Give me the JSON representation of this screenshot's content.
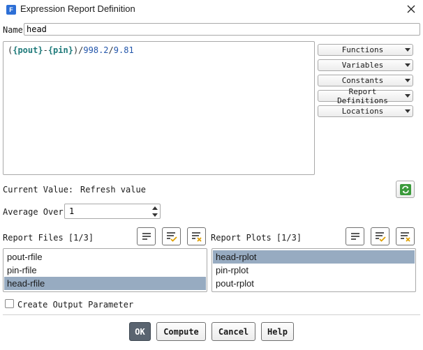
{
  "window": {
    "app_icon_letter": "F",
    "title": "Expression Report Definition"
  },
  "name": {
    "label": "Name",
    "value": "head"
  },
  "expression": {
    "open_paren": "(",
    "var1": "{pout}",
    "minus": "-",
    "var2": "{pin}",
    "rest_paren": ")/",
    "num1": "998.2",
    "slash": "/",
    "num2": "9.81"
  },
  "dropdowns": [
    {
      "label": "Functions"
    },
    {
      "label": "Variables"
    },
    {
      "label": "Constants"
    },
    {
      "label": "Report Definitions"
    },
    {
      "label": "Locations"
    }
  ],
  "current_value": {
    "label": "Current Value:",
    "value": "Refresh value"
  },
  "average_over": {
    "label": "Average Over",
    "value": "1"
  },
  "report_files": {
    "label": "Report Files [1/3]",
    "items": [
      "pout-rfile",
      "pin-rfile",
      "head-rfile"
    ],
    "selected_index": 2
  },
  "report_plots": {
    "label": "Report Plots [1/3]",
    "items": [
      "head-rplot",
      "pin-rplot",
      "pout-rplot"
    ],
    "selected_index": 0
  },
  "create_output": {
    "label": "Create Output Parameter",
    "checked": false
  },
  "buttons": {
    "ok": "OK",
    "compute": "Compute",
    "cancel": "Cancel",
    "help": "Help"
  },
  "colors": {
    "selection": "#97abc1",
    "primary_button": "#5a6470",
    "expr_variable": "#1f7a7a",
    "expr_number": "#2255aa"
  }
}
